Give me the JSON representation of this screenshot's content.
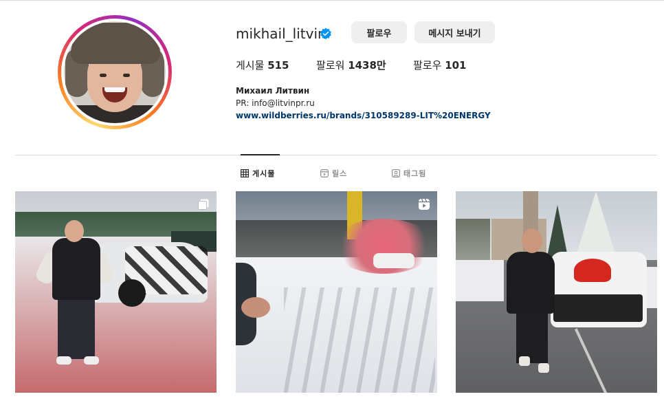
{
  "profile": {
    "username": "mikhail_litvin",
    "verified": true,
    "follow_label": "팔로우",
    "message_label": "메시지 보내기",
    "stats": {
      "posts_label": "게시물",
      "posts_value": "515",
      "followers_label": "팔로워",
      "followers_value": "1438만",
      "following_label": "팔로우",
      "following_value": "101"
    },
    "full_name": "Михаил Литвин",
    "bio": "PR: info@litvinpr.ru",
    "link": "www.wildberries.ru/brands/310589289-LIT%20ENERGY"
  },
  "tabs": [
    {
      "label": "게시물",
      "icon": "grid-icon",
      "active": true
    },
    {
      "label": "릴스",
      "icon": "reels-icon",
      "active": false
    },
    {
      "label": "태그됨",
      "icon": "tagged-icon",
      "active": false
    }
  ],
  "posts": [
    {
      "type": "carousel",
      "icon": "carousel-icon"
    },
    {
      "type": "reel",
      "icon": "reel-icon"
    },
    {
      "type": "image",
      "icon": ""
    }
  ],
  "colors": {
    "link": "#00376b",
    "verified": "#0095f6",
    "button_bg": "#efefef",
    "muted": "#8e8e8e"
  }
}
